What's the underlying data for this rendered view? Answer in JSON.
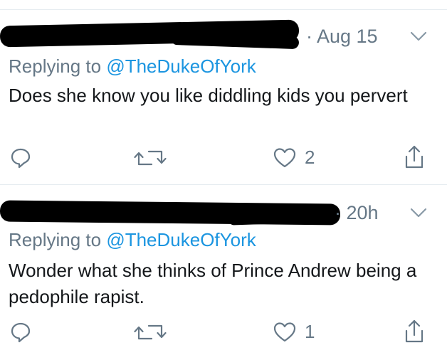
{
  "tweets": [
    {
      "timestamp": "· Aug 15",
      "replying_prefix": "Replying to ",
      "replying_handle": "@TheDukeOfYork",
      "text": "Does she know you like diddling kids you pervert",
      "like_count": "2"
    },
    {
      "timestamp": "· 20h",
      "replying_prefix": "Replying to ",
      "replying_handle": "@TheDukeOfYork",
      "text": "Wonder what she thinks of Prince Andrew being a pedophile rapist.",
      "like_count": "1"
    }
  ],
  "icons": {
    "reply": "reply-icon",
    "retweet": "retweet-icon",
    "like": "heart-icon",
    "share": "share-icon",
    "menu": "chevron-down-icon"
  },
  "colors": {
    "text": "#14171a",
    "muted": "#657786",
    "link": "#1b95e0",
    "divider": "#e6ecf0"
  }
}
